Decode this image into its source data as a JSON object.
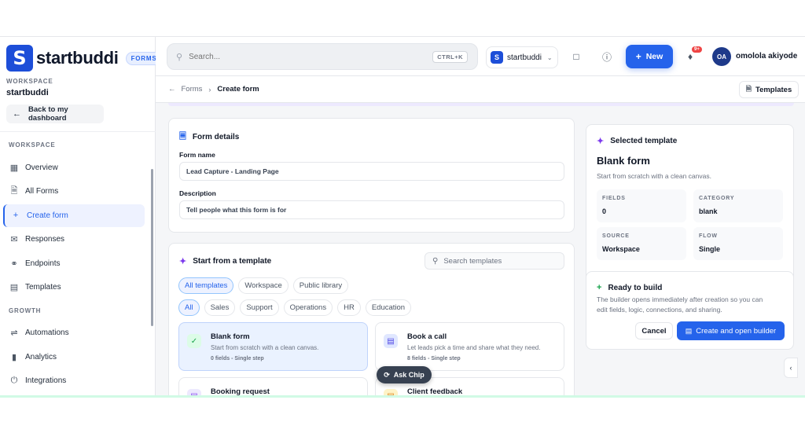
{
  "brand": {
    "mark": "S",
    "name": "startbuddi",
    "badge": "FORMS"
  },
  "workspace": {
    "label": "WORKSPACE",
    "name": "startbuddi",
    "back_label": "Back to my dashboard"
  },
  "sidebar": {
    "sections": [
      {
        "title": "WORKSPACE",
        "items": [
          {
            "label": "Overview",
            "icon": "grid-icon"
          },
          {
            "label": "All Forms",
            "icon": "document-icon"
          },
          {
            "label": "Create form",
            "icon": "plus-icon",
            "active": true
          },
          {
            "label": "Responses",
            "icon": "inbox-icon"
          },
          {
            "label": "Endpoints",
            "icon": "webhook-icon"
          },
          {
            "label": "Templates",
            "icon": "clipboard-icon"
          }
        ]
      },
      {
        "title": "GROWTH",
        "items": [
          {
            "label": "Automations",
            "icon": "automation-icon"
          },
          {
            "label": "Analytics",
            "icon": "bar-chart-icon"
          },
          {
            "label": "Integrations",
            "icon": "plug-icon"
          }
        ]
      }
    ]
  },
  "topbar": {
    "search_placeholder": "Search...",
    "search_shortcut": "CTRL+K",
    "workspace_switch": {
      "mark": "S",
      "name": "startbuddi"
    },
    "new_label": "New",
    "notification_badge": "9+",
    "user": {
      "initials": "OA",
      "name": "omolola akiyode"
    }
  },
  "breadcrumb": {
    "parent": "Forms",
    "current": "Create form",
    "templates_label": "Templates"
  },
  "form_details": {
    "title": "Form details",
    "name_label": "Form name",
    "name_value": "Lead Capture - Landing Page",
    "description_label": "Description",
    "description_value": "Tell people what this form is for"
  },
  "template_picker": {
    "title": "Start from a template",
    "search_placeholder": "Search templates",
    "sources": [
      "All templates",
      "Workspace",
      "Public library"
    ],
    "categories": [
      "All",
      "Sales",
      "Support",
      "Operations",
      "HR",
      "Education"
    ],
    "templates": [
      {
        "name": "Blank form",
        "desc": "Start from scratch with a clean canvas.",
        "meta": "0 fields - Single step",
        "selected": true
      },
      {
        "name": "Book a call",
        "desc": "Let leads pick a time and share what they need.",
        "meta": "8 fields - Single step"
      },
      {
        "name": "Booking request",
        "desc": "",
        "meta": ""
      },
      {
        "name": "Client feedback",
        "desc": "",
        "meta": ""
      }
    ]
  },
  "selected_template": {
    "header": "Selected template",
    "name": "Blank form",
    "desc": "Start from scratch with a clean canvas.",
    "stats": [
      {
        "key": "FIELDS",
        "value": "0"
      },
      {
        "key": "CATEGORY",
        "value": "blank"
      },
      {
        "key": "SOURCE",
        "value": "Workspace"
      },
      {
        "key": "FLOW",
        "value": "Single"
      }
    ]
  },
  "ready": {
    "title": "Ready to build",
    "text_line1": "The builder opens immediately after creation so you can",
    "text_line2": "edit fields, logic, connections, and sharing.",
    "cancel_label": "Cancel",
    "create_label": "Create and open builder"
  },
  "ask_chip": "Ask Chip",
  "colors": {
    "accent": "#2563eb",
    "brand": "#1d4ed8",
    "badge": "#ef4444"
  }
}
